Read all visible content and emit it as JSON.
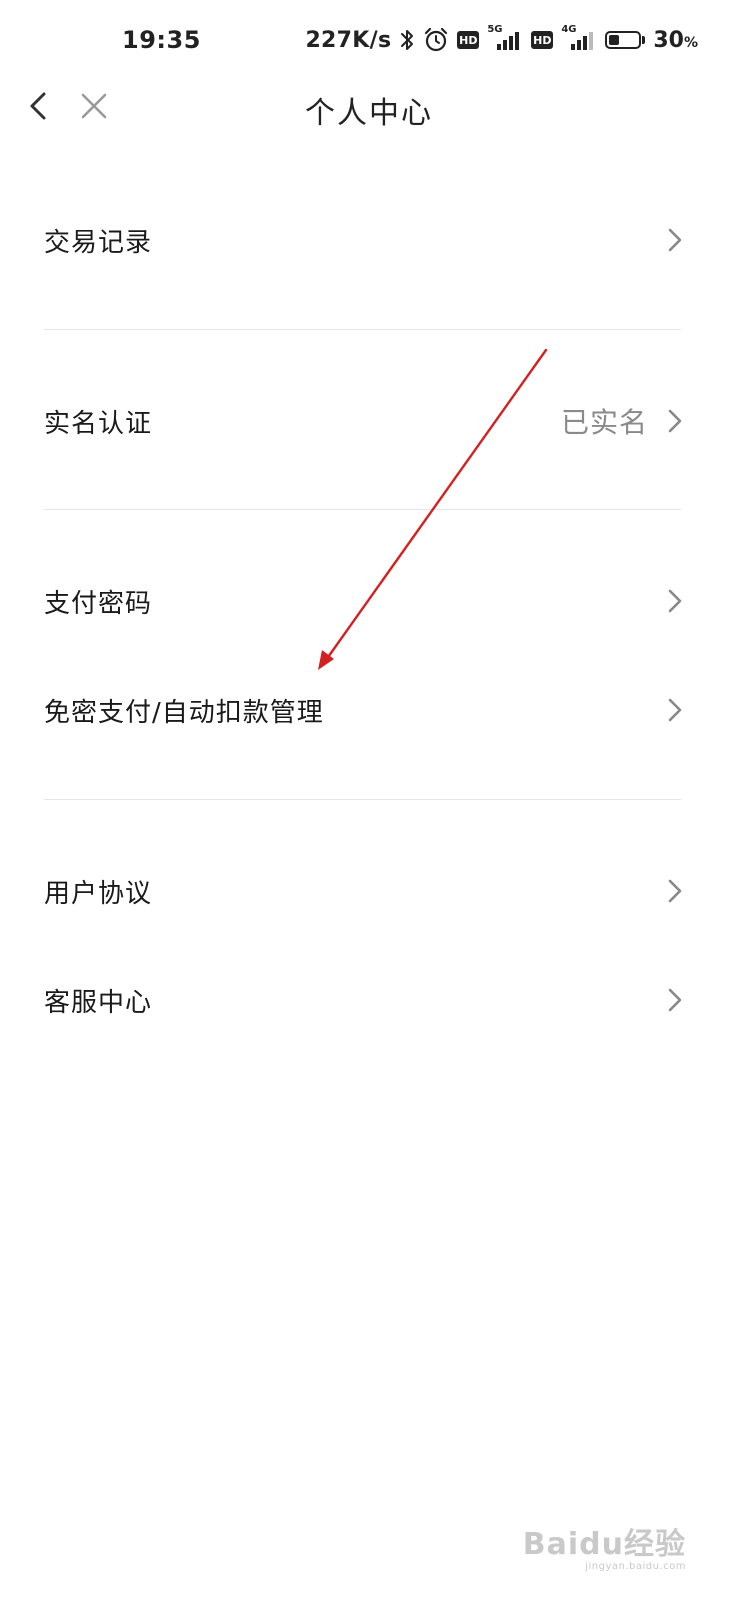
{
  "status_bar": {
    "time": "19:35",
    "net_speed": "227K/s",
    "hd_label": "HD",
    "net_type_1": "5G",
    "net_type_2": "4G",
    "battery_value": "30",
    "battery_unit": "%",
    "battery_level": 0.3,
    "icons": [
      "bluetooth-icon",
      "alarm-icon",
      "signal-icon",
      "battery-icon"
    ]
  },
  "nav": {
    "title": "个人中心",
    "back_icon": "chevron-left-icon",
    "close_icon": "close-icon"
  },
  "menu": {
    "items": [
      {
        "label": "交易记录",
        "value": ""
      },
      {
        "label": "实名认证",
        "value": "已实名"
      },
      {
        "label": "支付密码",
        "value": ""
      },
      {
        "label": "免密支付/自动扣款管理",
        "value": ""
      },
      {
        "label": "用户协议",
        "value": ""
      },
      {
        "label": "客服中心",
        "value": ""
      }
    ]
  },
  "annotation": {
    "color": "#d42020"
  },
  "watermark": {
    "brand": "Baidu经验",
    "url": "jingyan.baidu.com"
  }
}
